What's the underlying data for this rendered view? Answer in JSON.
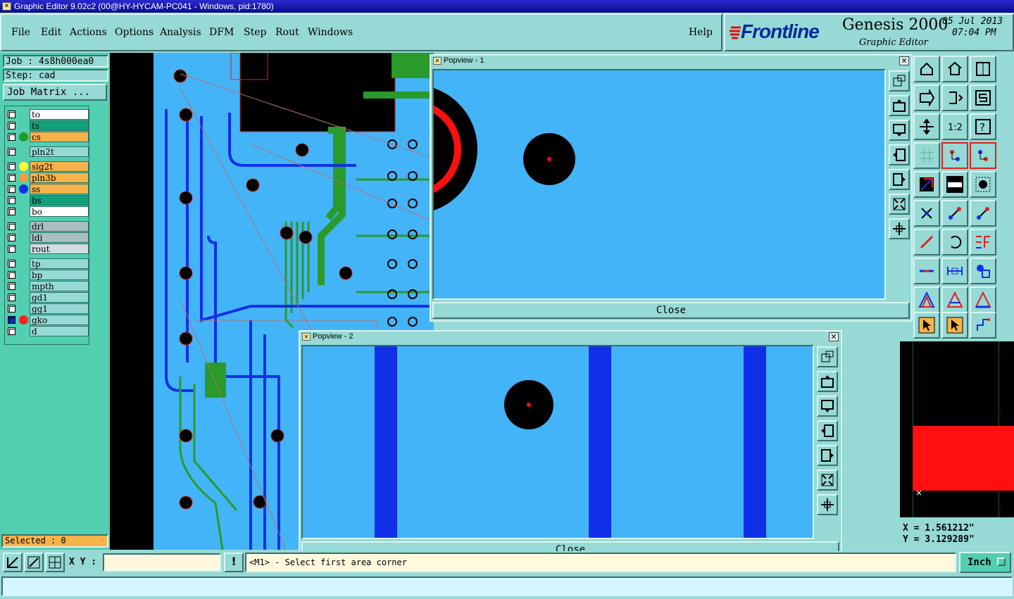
{
  "window": {
    "title": "Graphic Editor 9.02c2 (00@HY-HYCAM-PC041 - Windows, pid:1780)"
  },
  "menu": [
    "File",
    "Edit",
    "Actions",
    "Options",
    "Analysis",
    "DFM",
    "Step",
    "Rout",
    "Windows"
  ],
  "help": "Help",
  "brand": {
    "logo": "Frontline",
    "product": "Genesis 2000",
    "subtitle": "Graphic Editor",
    "date": "05 Jul 2013",
    "time": "07:04 PM"
  },
  "job": {
    "job_label": "Job : 4s8h000ea0",
    "step_label": "Step: cad",
    "matrix_button": "Job Matrix ..."
  },
  "layers": [
    {
      "name": "to",
      "color": "#ffffff",
      "dot": ""
    },
    {
      "name": "ts",
      "color": "#12a07a",
      "dot": ""
    },
    {
      "name": "cs",
      "color": "#f6b34a",
      "dot": "#1f9a2c"
    },
    {
      "name": "pln2t",
      "color": "#97d9d4",
      "dot": ""
    },
    {
      "name": "sig2t",
      "color": "#f6b34a",
      "dot": "#ffff30"
    },
    {
      "name": "pln3b",
      "color": "#f6b34a",
      "dot": "#f69a3a"
    },
    {
      "name": "ss",
      "color": "#f6b34a",
      "dot": "#1030e8"
    },
    {
      "name": "bs",
      "color": "#12a07a",
      "dot": ""
    },
    {
      "name": "bo",
      "color": "#ffffff",
      "dot": ""
    },
    {
      "name": "drl",
      "color": "#a9bfc4",
      "dot": ""
    },
    {
      "name": "ldi",
      "color": "#a9bfc4",
      "dot": ""
    },
    {
      "name": "rout",
      "color": "#cfdde0",
      "dot": ""
    },
    {
      "name": "tp",
      "color": "#97d9d4",
      "dot": ""
    },
    {
      "name": "bp",
      "color": "#97d9d4",
      "dot": ""
    },
    {
      "name": "mpth",
      "color": "#97d9d4",
      "dot": ""
    },
    {
      "name": "gd1",
      "color": "#97d9d4",
      "dot": ""
    },
    {
      "name": "gg1",
      "color": "#97d9d4",
      "dot": ""
    },
    {
      "name": "gko",
      "color": "#97d9d4",
      "dot": "#ff2020"
    },
    {
      "name": "d",
      "color": "#97d9d4",
      "dot": ""
    }
  ],
  "selected": "Selected : 0",
  "popview1": {
    "title": "Popview - 1",
    "close": "Close"
  },
  "popview2": {
    "title": "Popview - 2",
    "close": "Close"
  },
  "coords": {
    "x": "X = 1.561212\"",
    "y": "Y = 3.129289\""
  },
  "bottom": {
    "xy_label": "X Y :",
    "xy_value": "",
    "message": "<M1> - Select first area corner",
    "unit": "Inch"
  },
  "colors": {
    "board": "#44b4f8",
    "trace": "#1030e8",
    "green": "#2a9a2a",
    "red": "#ff1010"
  }
}
